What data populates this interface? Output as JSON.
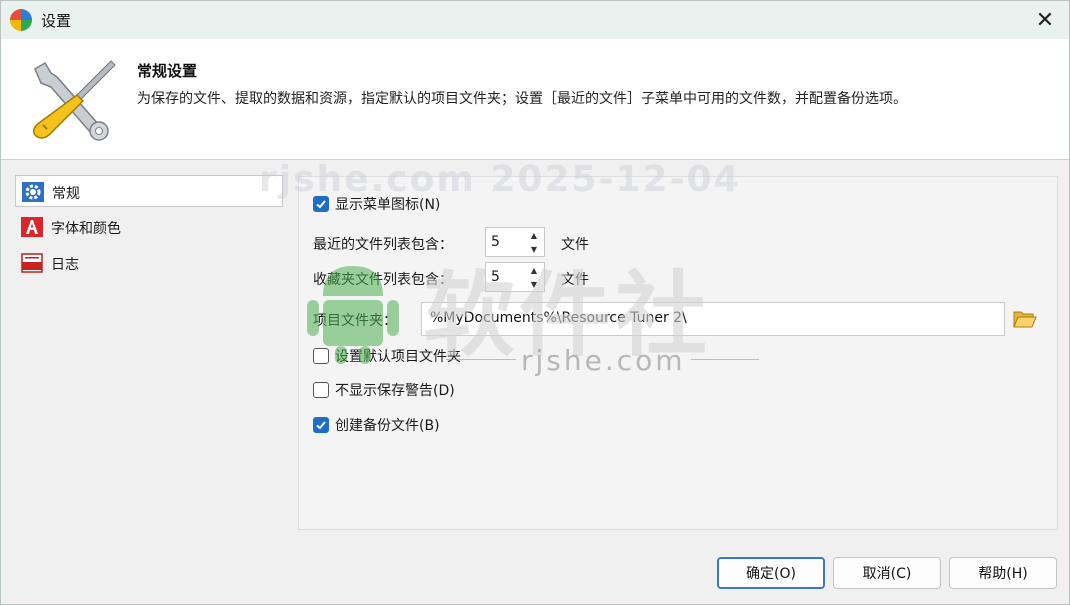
{
  "window": {
    "title": "设置",
    "close_glyph": "✕"
  },
  "header": {
    "title": "常规设置",
    "description": "为保存的文件、提取的数据和资源，指定默认的项目文件夹；设置［最近的文件］子菜单中可用的文件数，并配置备份选项。"
  },
  "sidebar": {
    "items": [
      {
        "label": "常规",
        "icon": "gear-icon",
        "selected": true
      },
      {
        "label": "字体和颜色",
        "icon": "font-color-icon",
        "selected": false
      },
      {
        "label": "日志",
        "icon": "log-icon",
        "selected": false
      }
    ]
  },
  "general": {
    "show_menu_icons": {
      "label": "显示菜单图标(N)",
      "checked": true
    },
    "recent_files": {
      "label": "最近的文件列表包含：",
      "value": "5",
      "unit": "文件"
    },
    "favorite_files": {
      "label": "收藏夹文件列表包含：",
      "value": "5",
      "unit": "文件"
    },
    "project_folder": {
      "label": "项目文件夹：",
      "value": "%MyDocuments%\\Resource Tuner 2\\"
    },
    "set_default_folder": {
      "label": "设置默认项目文件夹",
      "checked": false
    },
    "no_save_warning": {
      "label": "不显示保存警告(D)",
      "checked": false
    },
    "create_backup": {
      "label": "创建备份文件(B)",
      "checked": true
    }
  },
  "buttons": {
    "ok": "确定(O)",
    "cancel": "取消(C)",
    "help": "帮助(H)"
  },
  "watermark": {
    "top_text": "rjshe.com 2025-12-04",
    "brand": "软件社",
    "site": "rjshe.com"
  },
  "colors": {
    "accent": "#1e6ec8",
    "title_bar": "#eaf2f0"
  }
}
